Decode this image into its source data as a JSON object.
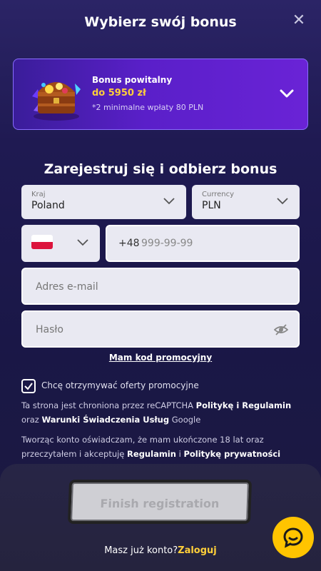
{
  "header": {
    "title": "Wybierz swój bonus",
    "close_icon": "close-icon"
  },
  "bonus": {
    "label": "Bonus powitalny",
    "amount": "do 5950 zł",
    "note": "*2 minimalne wpłaty 80 PLN",
    "image": "treasure-chest-icon",
    "accent": "#ffcf3a"
  },
  "form": {
    "title": "Zarejestruj się i odbierz bonus",
    "country": {
      "label": "Kraj",
      "value": "Poland"
    },
    "currency": {
      "label": "Currency",
      "value": "PLN"
    },
    "phone": {
      "prefix": "+48",
      "placeholder": "999-99-99"
    },
    "email": {
      "placeholder": "Adres e-mail"
    },
    "password": {
      "placeholder": "Hasło"
    },
    "promo_link": "Mam kod promocyjny",
    "offers_checkbox": {
      "label": "Chcę otrzymywać oferty promocyjne",
      "checked": true
    }
  },
  "legal": {
    "recaptcha": {
      "t1": "Ta strona jest chroniona przez reCAPTCHA ",
      "policy": "Politykę i Regulamin",
      "t2": "oraz ",
      "terms": "Warunki Świadczenia Usług",
      "t3": " Google"
    },
    "age": {
      "t1": "Tworząc konto oświadczam, że mam ukończone 18 lat oraz przeczytałem i akceptuję ",
      "rules": "Regulamin",
      "t2": " i ",
      "privacy": "Politykę prywatności"
    }
  },
  "footer": {
    "finish_button": "Finish registration",
    "have_account": "Masz już konto?",
    "login_link": "Zaloguj",
    "chat_icon": "chat-icon"
  }
}
